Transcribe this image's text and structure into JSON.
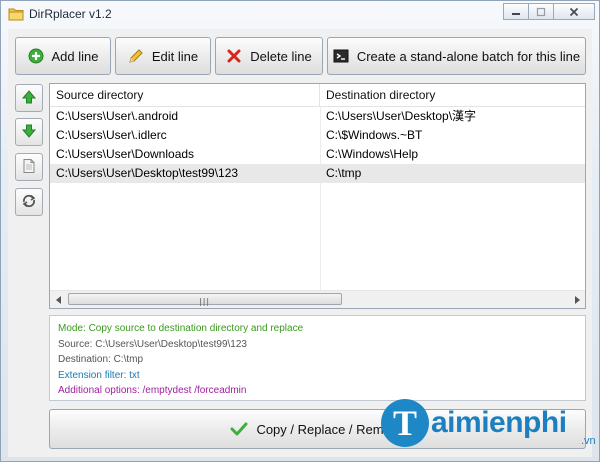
{
  "window": {
    "title": "DirRplacer v1.2"
  },
  "toolbar": {
    "add_line": "Add line",
    "edit_line": "Edit line",
    "delete_line": "Delete line",
    "create_batch": "Create a stand-alone batch for this line"
  },
  "list": {
    "columns": [
      "Source directory",
      "Destination directory"
    ],
    "rows": [
      {
        "source": "C:\\Users\\User\\.android",
        "destination": "C:\\Users\\User\\Desktop\\漢字"
      },
      {
        "source": "C:\\Users\\User\\.idlerc",
        "destination": "C:\\$Windows.~BT"
      },
      {
        "source": "C:\\Users\\User\\Downloads",
        "destination": "C:\\Windows\\Help"
      },
      {
        "source": "C:\\Users\\User\\Desktop\\test99\\123",
        "destination": "C:\\tmp"
      }
    ],
    "selected_index": 3
  },
  "info": {
    "mode": "Mode: Copy source to destination directory and replace",
    "source": "Source: C:\\Users\\User\\Desktop\\test99\\123",
    "destination": "Destination: C:\\tmp",
    "extension_filter": "Extension filter: txt",
    "additional_options": "Additional options: /emptydest /forceadmin"
  },
  "main_button": {
    "label": "Copy / Replace / Remove"
  },
  "watermark": {
    "logo_letter": "T",
    "text": "aimienphi",
    "suffix": ".vn"
  },
  "colors": {
    "mode": "#3a9a1c",
    "source": "#555555",
    "destination": "#555555",
    "extension_filter": "#1a7bb5",
    "additional_options": "#a020a0"
  },
  "icons": {
    "title": "folder-icon",
    "add": "plus-circle-icon",
    "edit": "pencil-icon",
    "delete": "x-icon",
    "batch": "console-icon",
    "up": "arrow-up-icon",
    "down": "arrow-down-icon",
    "copy": "document-icon",
    "swap": "swap-icon",
    "run": "checkmark-icon"
  }
}
